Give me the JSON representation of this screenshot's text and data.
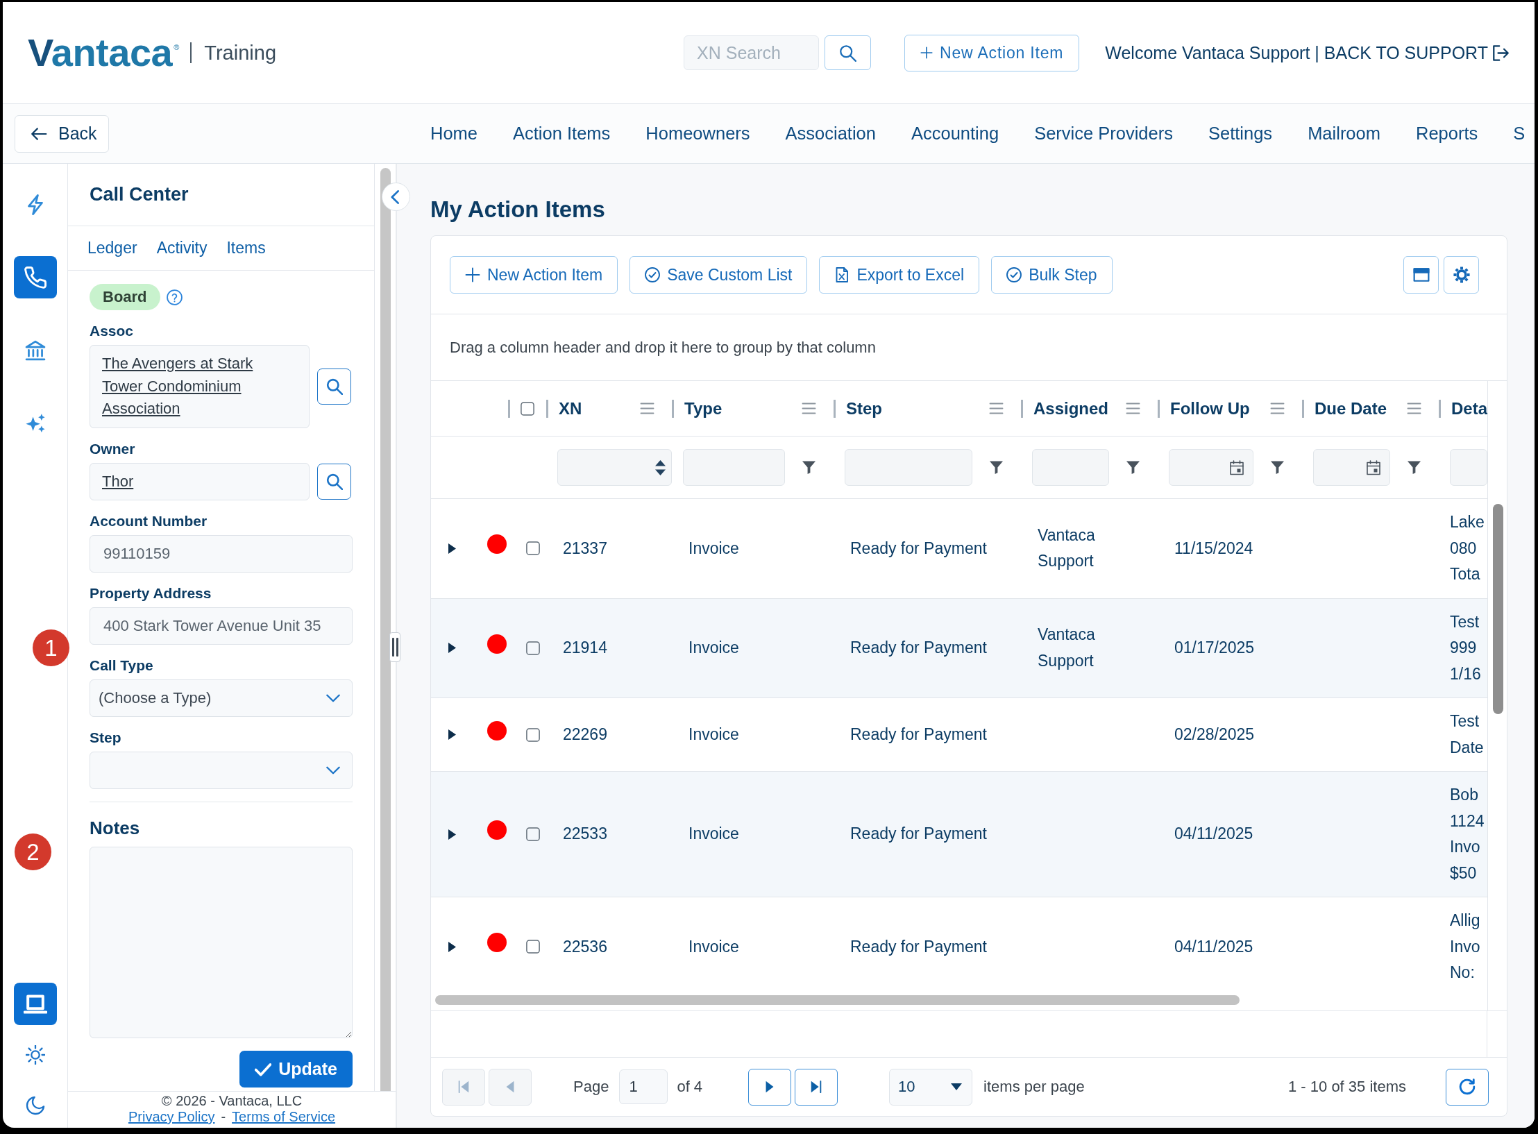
{
  "header": {
    "logo": {
      "name": "Vantaca",
      "mark": "®"
    },
    "environment": "Training",
    "search": {
      "placeholder": "XN Search"
    },
    "new_action_item": "New Action Item",
    "welcome": "Welcome Vantaca Support |",
    "back_to_support": "BACK TO SUPPORT"
  },
  "nav": {
    "back": "Back",
    "items": [
      "Home",
      "Action Items",
      "Homeowners",
      "Association",
      "Accounting",
      "Service Providers",
      "Settings",
      "Mailroom",
      "Reports",
      "S"
    ]
  },
  "rail": {
    "items": [
      {
        "kind": "lightning",
        "selected": false
      },
      {
        "kind": "phone",
        "selected": true
      },
      {
        "kind": "bank",
        "selected": false
      },
      {
        "kind": "sparkles",
        "selected": false
      }
    ],
    "themes": [
      {
        "kind": "laptop",
        "selected": true
      },
      {
        "kind": "sun",
        "selected": false
      },
      {
        "kind": "moon",
        "selected": false
      }
    ]
  },
  "annotations": [
    {
      "label": "1"
    },
    {
      "label": "2"
    }
  ],
  "panel": {
    "title": "Call Center",
    "tabs": [
      "Ledger",
      "Activity",
      "Items"
    ],
    "tag": "Board",
    "fields": [
      {
        "kind": "lookup",
        "label": "Assoc",
        "value": "The Avengers at Stark Tower Condominium Association"
      },
      {
        "kind": "lookup",
        "label": "Owner",
        "value": "Thor"
      },
      {
        "kind": "text",
        "label": "Account Number",
        "value": "99110159"
      },
      {
        "kind": "text",
        "label": "Property Address",
        "value": "400 Stark Tower Avenue Unit 35"
      },
      {
        "kind": "select",
        "label": "Call Type",
        "value": "(Choose a Type)"
      },
      {
        "kind": "select",
        "label": "Step"
      }
    ],
    "notes": {
      "label": "Notes"
    },
    "update": "Update",
    "footer": {
      "copyright": "© 2026 - Vantaca, LLC",
      "links": [
        "Privacy Policy",
        "Terms of Service"
      ],
      "separator": "-"
    }
  },
  "main": {
    "title": "My Action Items",
    "toolbar": [
      {
        "kind": "plus",
        "label": "New Action Item"
      },
      {
        "kind": "check",
        "label": "Save Custom List"
      },
      {
        "kind": "excel",
        "label": "Export to Excel"
      },
      {
        "kind": "check",
        "label": "Bulk Step"
      }
    ],
    "tools": [
      {
        "kind": "window"
      },
      {
        "kind": "gear"
      }
    ],
    "group_hint": "Drag a column header and drop it here to group by that column",
    "select_all": {
      "checked": false
    },
    "columns": [
      {
        "label": "XN",
        "kind": "number"
      },
      {
        "label": "Type",
        "kind": "text"
      },
      {
        "label": "Step",
        "kind": "text"
      },
      {
        "label": "Assigned",
        "kind": "text"
      },
      {
        "label": "Follow Up",
        "kind": "date"
      },
      {
        "label": "Due Date",
        "kind": "date"
      },
      {
        "label": "Deta",
        "kind": "text"
      }
    ],
    "rows": [
      {
        "expanded": false,
        "color": "#ff0000",
        "checked": false,
        "xn": "21337",
        "type": "Invoice",
        "step": "Ready for Payment",
        "assigned": "Vantaca Support",
        "follow_up": "11/15/2024",
        "details": [
          "Lake",
          "080",
          "Tota"
        ]
      },
      {
        "expanded": false,
        "color": "#ff0000",
        "checked": false,
        "xn": "21914",
        "type": "Invoice",
        "step": "Ready for Payment",
        "assigned": "Vantaca Support",
        "follow_up": "01/17/2025",
        "details": [
          "Test",
          "999",
          "1/16"
        ]
      },
      {
        "expanded": false,
        "color": "#ff0000",
        "checked": false,
        "xn": "22269",
        "type": "Invoice",
        "step": "Ready for Payment",
        "follow_up": "02/28/2025",
        "details": [
          "Test",
          "Date"
        ]
      },
      {
        "expanded": false,
        "color": "#ff0000",
        "checked": false,
        "xn": "22533",
        "type": "Invoice",
        "step": "Ready for Payment",
        "follow_up": "04/11/2025",
        "details": [
          "Bob",
          "1124",
          "Invo",
          "$50"
        ]
      },
      {
        "expanded": false,
        "color": "#ff0000",
        "checked": false,
        "xn": "22536",
        "type": "Invoice",
        "step": "Ready for Payment",
        "follow_up": "04/11/2025",
        "details": [
          "Allig",
          "Invo",
          "No:"
        ]
      }
    ],
    "pager": {
      "buttons": [
        {
          "kind": "first",
          "disabled": true
        },
        {
          "kind": "prev",
          "disabled": true
        },
        {
          "kind": "next",
          "disabled": false
        },
        {
          "kind": "last",
          "disabled": false
        }
      ],
      "page_label": "Page",
      "page": "1",
      "of": "of 4",
      "page_size": "10",
      "per_page": "items per page",
      "summary": "1 - 10 of 35 items"
    }
  }
}
